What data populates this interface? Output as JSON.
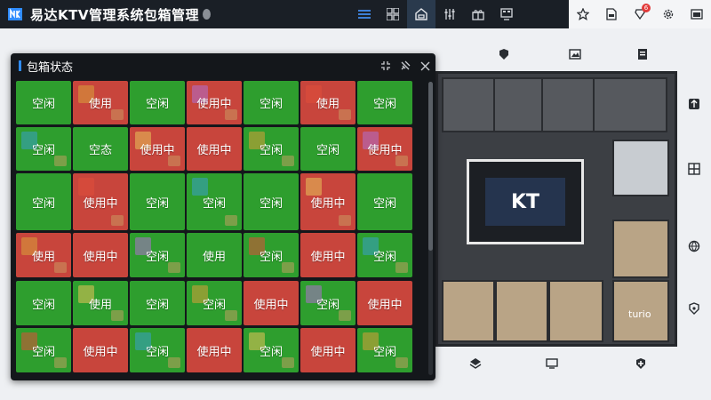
{
  "app": {
    "title": "易达KTV管理系统包箱管理"
  },
  "nav": [
    "list-icon",
    "grid-icon",
    "room-icon",
    "tools-icon",
    "gift-icon",
    "monitor-icon"
  ],
  "right": {
    "badge_count": "6"
  },
  "panel": {
    "title": "包箱状态"
  },
  "floor": {
    "screen_label": "KT",
    "room_label": "turio"
  },
  "colors": {
    "idle": "#2e9e2e",
    "busy": "#c8453c",
    "accent": "#2f8cff"
  },
  "rooms": [
    [
      "空闲",
      "使用",
      "空闲",
      "使用中",
      "空闲",
      "使用",
      "空闲"
    ],
    [
      "空闲",
      "空态",
      "使用中",
      "使用中",
      "空闲",
      "空闲",
      "使用中"
    ],
    [
      "空闲",
      "使用中",
      "空闲",
      "空闲",
      "空闲",
      "使用中",
      "空闲"
    ],
    [
      "使用",
      "使用中",
      "空闲",
      "使用",
      "空闲",
      "使用中",
      "空闲"
    ],
    [
      "空闲",
      "使用",
      "空闲",
      "空闲",
      "使用中",
      "空闲",
      "使用中"
    ],
    [
      "空闲",
      "使用中",
      "空闲",
      "使用中",
      "空闲",
      "使用中",
      "空闲"
    ]
  ],
  "room_status": [
    [
      "idle",
      "busy",
      "idle",
      "busy",
      "idle",
      "busy",
      "idle"
    ],
    [
      "idle",
      "idle",
      "busy",
      "busy",
      "idle",
      "idle",
      "busy"
    ],
    [
      "idle",
      "busy",
      "idle",
      "idle",
      "idle",
      "busy",
      "idle"
    ],
    [
      "busy",
      "busy",
      "idle",
      "idle",
      "idle",
      "busy",
      "idle"
    ],
    [
      "idle",
      "idle",
      "idle",
      "idle",
      "busy",
      "idle",
      "busy"
    ],
    [
      "idle",
      "busy",
      "idle",
      "busy",
      "idle",
      "busy",
      "idle"
    ]
  ]
}
